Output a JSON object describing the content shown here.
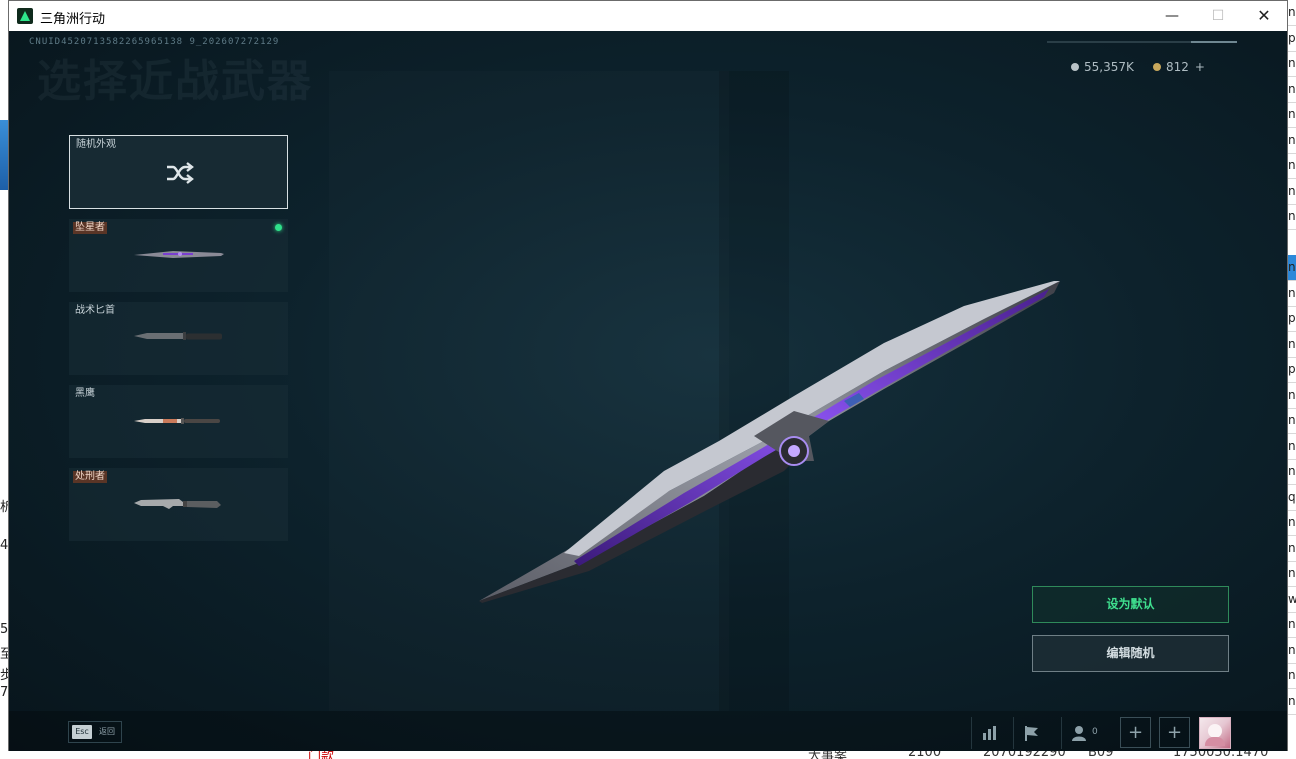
{
  "window": {
    "title": "三角洲行动",
    "controls": {
      "minimize": "—",
      "maximize": "☐",
      "close": "✕"
    }
  },
  "header": {
    "uid": "CNUID4520713582265965138 9_202607272129",
    "page_title": "选择近战武器",
    "currency": [
      {
        "name": "silver-coin",
        "value": "55,357K",
        "color": "#b9c3c7"
      },
      {
        "name": "gold-coin",
        "value": "812",
        "color": "#c8a85c",
        "plus": "+"
      }
    ]
  },
  "weapon_list": {
    "random": {
      "label": "随机外观",
      "icon": "shuffle-icon"
    },
    "items": [
      {
        "label": "坠星者",
        "tagged": true,
        "equipped": true,
        "icon": "starfall-knife-thumb"
      },
      {
        "label": "战术匕首",
        "tagged": false,
        "equipped": false,
        "icon": "tactical-dagger-thumb"
      },
      {
        "label": "黑鹰",
        "tagged": false,
        "equipped": false,
        "icon": "blackhawk-knife-thumb"
      },
      {
        "label": "处刑者",
        "tagged": true,
        "equipped": false,
        "icon": "executioner-knife-thumb"
      }
    ]
  },
  "actions": {
    "set_default": "设为默认",
    "edit_random": "编辑随机"
  },
  "footer": {
    "esc_key": "Esc",
    "esc_label": "返回",
    "friends_count": "0",
    "icons": [
      "stats-icon",
      "flag-icon",
      "friends-icon",
      "add-icon",
      "add-icon",
      "avatar"
    ]
  },
  "background_app": {
    "left_chars": [
      "析",
      "4",
      "5",
      "至",
      "步",
      "7"
    ],
    "bottom_texts": [
      "门款",
      "大事案",
      "2100",
      "2070192290",
      "B09",
      "1750050:1470"
    ],
    "right_chars": [
      "n",
      "p",
      "n",
      "n",
      "n",
      "n",
      "n",
      "n",
      "n",
      "",
      "n",
      "n",
      "p",
      "n",
      "p",
      "n",
      "n",
      "n",
      "n",
      "q",
      "n",
      "n",
      "n",
      "w",
      "n",
      "n",
      "n",
      "n"
    ]
  },
  "colors": {
    "accent_green": "#3fe08f",
    "window_bg": "#0b1a22"
  }
}
